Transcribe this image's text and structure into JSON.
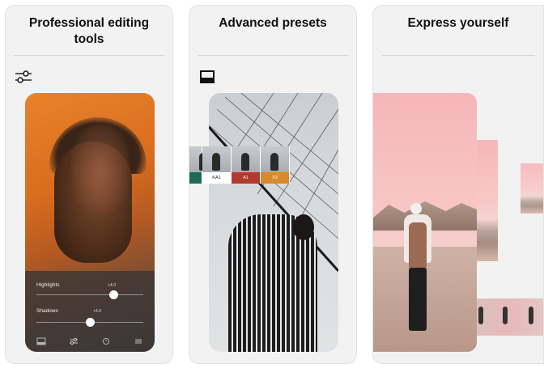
{
  "cards": [
    {
      "title": "Professional editing tools",
      "icon": "sliders-icon"
    },
    {
      "title": "Advanced presets",
      "icon": "presets-icon"
    },
    {
      "title": "Express yourself",
      "icon": ""
    }
  ],
  "editor": {
    "sliders": [
      {
        "label": "Highlights",
        "value": "+4.0",
        "level": 0.72
      },
      {
        "label": "Shadows",
        "value": "+4.0",
        "level": 0.5
      }
    ],
    "toolbar": [
      "presets-icon",
      "sliders-icon",
      "history-icon",
      "export-icon"
    ]
  },
  "presets": [
    {
      "label": "",
      "color": "#1f6b5a"
    },
    {
      "label": "KA1",
      "color": "#ffffff"
    },
    {
      "label": "A1",
      "color": "#b23a2e"
    },
    {
      "label": "X3",
      "color": "#d98a2a"
    }
  ]
}
